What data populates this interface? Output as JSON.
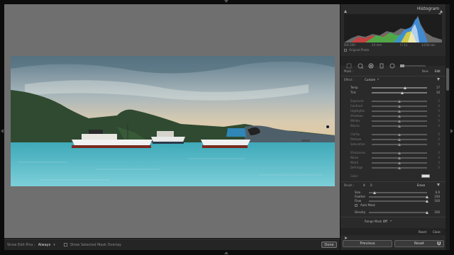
{
  "histogram": {
    "title": "Histogram",
    "stats": [
      "ISO 200",
      "14 mm",
      "f / 11",
      "1/250 sec"
    ],
    "original_photo_label": "Original Photo"
  },
  "mask": {
    "label": "Mask :",
    "new_label": "New",
    "edit_label": "Edit"
  },
  "effect": {
    "label": "Effect :",
    "preset": "Custom"
  },
  "sliders": [
    {
      "label": "Temp",
      "value": "17",
      "level": 0.6,
      "active": true
    },
    {
      "label": "Tint",
      "value": "10",
      "level": 0.55,
      "active": true
    },
    {
      "label": "Exposure",
      "value": "0",
      "level": 0.5,
      "active": false
    },
    {
      "label": "Contrast",
      "value": "0",
      "level": 0.5,
      "active": false
    },
    {
      "label": "Highlights",
      "value": "0",
      "level": 0.5,
      "active": false
    },
    {
      "label": "Shadows",
      "value": "0",
      "level": 0.5,
      "active": false
    },
    {
      "label": "Whites",
      "value": "0",
      "level": 0.5,
      "active": false
    },
    {
      "label": "Blacks",
      "value": "0",
      "level": 0.5,
      "active": false
    },
    {
      "label": "Clarity",
      "value": "0",
      "level": 0.5,
      "active": false
    },
    {
      "label": "Dehaze",
      "value": "0",
      "level": 0.5,
      "active": false
    },
    {
      "label": "Saturation",
      "value": "0",
      "level": 0.5,
      "active": false
    },
    {
      "label": "Sharpness",
      "value": "0",
      "level": 0.5,
      "active": false
    },
    {
      "label": "Noise",
      "value": "0",
      "level": 0.5,
      "active": false
    },
    {
      "label": "Moiré",
      "value": "0",
      "level": 0.5,
      "active": false
    },
    {
      "label": "Defringe",
      "value": "0",
      "level": 0.5,
      "active": false
    }
  ],
  "color_label": "Color",
  "brush": {
    "label": "Brush :",
    "a": "A",
    "b": "B",
    "erase": "Erase",
    "rows": [
      {
        "label": "Size",
        "value": "6.0",
        "level": 0.1
      },
      {
        "label": "Feather",
        "value": "100",
        "level": 1.0
      },
      {
        "label": "Flow",
        "value": "100",
        "level": 1.0
      }
    ],
    "auto_mask": "Auto Mask",
    "density": {
      "label": "Density",
      "value": "100",
      "level": 1.0
    }
  },
  "range_mask": {
    "label": "Range Mask :",
    "value": "Off"
  },
  "panel_footer": {
    "reset": "Reset",
    "close": "Close"
  },
  "buttons": {
    "previous": "Previous",
    "reset": "Reset"
  },
  "toolbar": {
    "show_edit_pins_label": "Show Edit Pins :",
    "show_edit_pins_value": "Always",
    "overlay_label": "Show Selected Mask Overlay",
    "done": "Done"
  },
  "watermark": "U"
}
